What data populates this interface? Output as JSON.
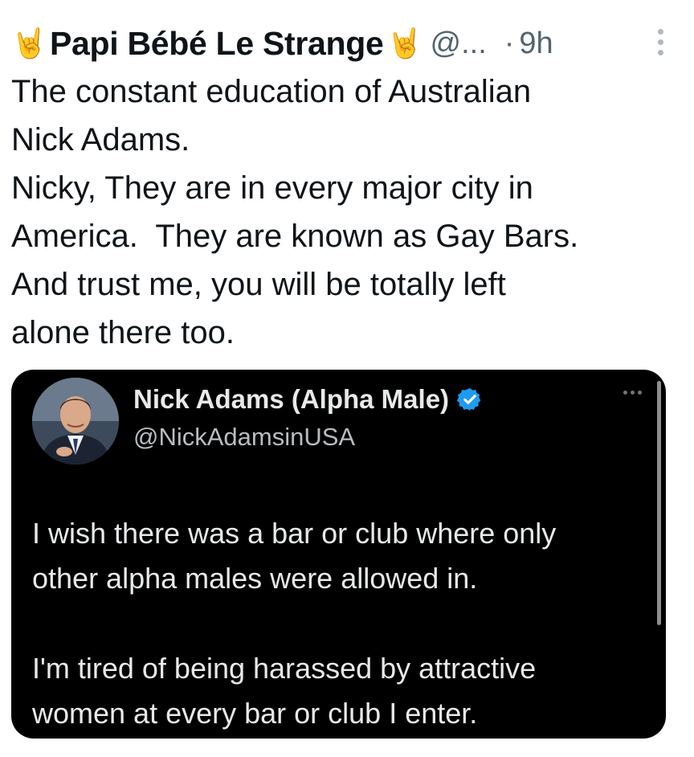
{
  "tweet": {
    "author": {
      "emoji": "🤘",
      "display_name": "Papi Bébé Le Strange",
      "handle": "@...",
      "separator": "·",
      "time": "9h"
    },
    "text_lines": [
      "The constant education of Australian",
      "Nick Adams.",
      "Nicky, They are in every major city in",
      "America.  They are known as Gay Bars.",
      "And trust me, you will be totally left",
      "alone there too."
    ],
    "icons": {
      "overflow_menu": "vertical-ellipsis-icon"
    }
  },
  "quoted": {
    "name": "Nick Adams (Alpha Male)",
    "handle": "@NickAdamsinUSA",
    "verified_icon": "verified-badge-icon",
    "verified_color": "#1d9bf0",
    "paragraph1_lines": [
      "I wish there was a bar or club where only",
      "other alpha males were allowed in."
    ],
    "paragraph2_lines": [
      "I'm tired of being harassed by attractive",
      "women at every bar or club I enter."
    ]
  },
  "colors": {
    "text": "#0f1419",
    "secondary": "#536471",
    "card_background": "#000000",
    "card_text": "#e7e9ea"
  }
}
